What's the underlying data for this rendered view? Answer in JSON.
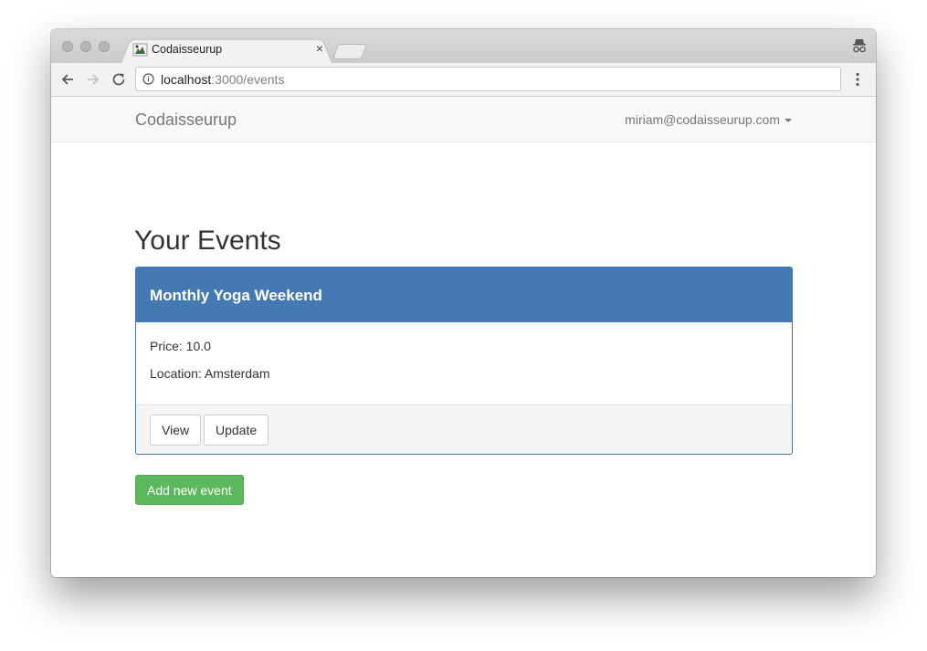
{
  "browser": {
    "tab_title": "Codaisseurup",
    "url_host": "localhost",
    "url_rest": ":3000/events"
  },
  "app": {
    "brand": "Codaisseurup",
    "user_email": "miriam@codaisseurup.com"
  },
  "main": {
    "heading": "Your Events",
    "events": [
      {
        "title": "Monthly Yoga Weekend",
        "price_label": "Price: 10.0",
        "location_label": "Location: Amsterdam",
        "view_label": "View",
        "update_label": "Update"
      }
    ],
    "add_button_label": "Add new event"
  },
  "colors": {
    "panel_header": "#4479b3",
    "success_button": "#5cb85c",
    "navbar_bg": "#f8f8f8"
  }
}
